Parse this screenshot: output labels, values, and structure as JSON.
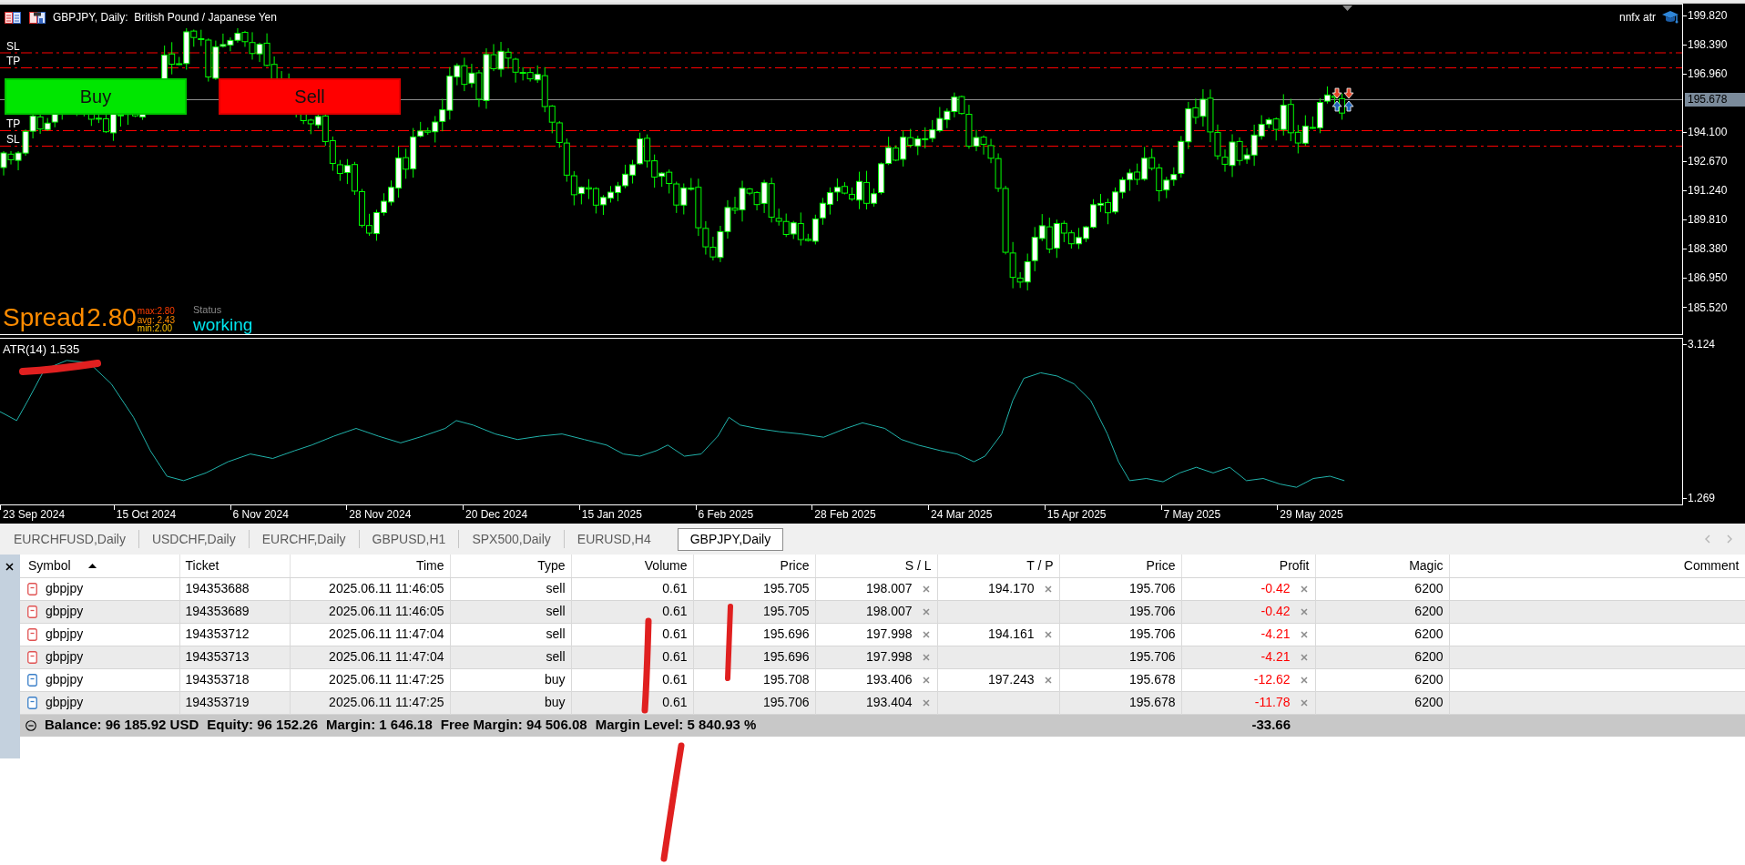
{
  "chart_window": {
    "title": "GBPJPY, Daily:  British Pound / Japanese Yen",
    "expert_name": "nnfx atr",
    "levels": [
      {
        "label": "SL"
      },
      {
        "label": "TP"
      },
      {
        "label": "TP"
      },
      {
        "label": "SL"
      }
    ],
    "trade_buttons": [
      {
        "kind": "buy",
        "label": "Buy"
      },
      {
        "kind": "sell",
        "label": "Sell"
      }
    ],
    "spread": {
      "label": "Spread",
      "value": "2.80",
      "stats": [
        {
          "kind": "max",
          "text": "max:2.80"
        },
        {
          "kind": "avg",
          "text": "avg: 2.43"
        },
        {
          "kind": "min",
          "text": "min:2.00"
        }
      ]
    },
    "status": {
      "label": "Status",
      "value": "working"
    },
    "price_axis": [
      "199.820",
      "198.390",
      "196.960",
      "194.100",
      "192.670",
      "191.240",
      "189.810",
      "188.380",
      "186.950",
      "185.520"
    ],
    "current_price": "195.678",
    "indicator": {
      "label": "ATR(14) 1.535",
      "axis": [
        "3.124",
        "1.269"
      ]
    },
    "date_axis": [
      "23 Sep 2024",
      "15 Oct 2024",
      "6 Nov 2024",
      "28 Nov 2024",
      "20 Dec 2024",
      "15 Jan 2025",
      "6 Feb 2025",
      "28 Feb 2025",
      "24 Mar 2025",
      "15 Apr 2025",
      "7 May 2025",
      "29 May 2025"
    ]
  },
  "chart_tabs": [
    {
      "label": "EURCHFUSD,Daily",
      "selected": false
    },
    {
      "label": "USDCHF,Daily",
      "selected": false
    },
    {
      "label": "EURCHF,Daily",
      "selected": false
    },
    {
      "label": "GBPUSD,H1",
      "selected": false
    },
    {
      "label": "SPX500,Daily",
      "selected": false
    },
    {
      "label": "EURUSD,H4",
      "selected": false
    },
    {
      "label": "GBPJPY,Daily",
      "selected": true
    }
  ],
  "trade_table": {
    "columns": [
      {
        "label": "Symbol",
        "sort_ascending": true
      },
      {
        "label": "Ticket"
      },
      {
        "label": "Time"
      },
      {
        "label": "Type"
      },
      {
        "label": "Volume"
      },
      {
        "label": "Price"
      },
      {
        "label": "S / L"
      },
      {
        "label": "T / P"
      },
      {
        "label": "Price"
      },
      {
        "label": "Profit"
      },
      {
        "label": "Magic"
      },
      {
        "label": "Comment"
      }
    ],
    "rows": [
      {
        "kind": "sell",
        "symbol": "gbpjpy",
        "ticket": "194353688",
        "time": "2025.06.11 11:46:05",
        "type": "sell",
        "volume": "0.61",
        "price": "195.705",
        "sl": "198.007",
        "tp": "194.170",
        "current_price": "195.706",
        "profit": "-0.42",
        "loss": true,
        "magic": "6200"
      },
      {
        "kind": "sell",
        "symbol": "gbpjpy",
        "ticket": "194353689",
        "time": "2025.06.11 11:46:05",
        "type": "sell",
        "volume": "0.61",
        "price": "195.705",
        "sl": "198.007",
        "current_price": "195.706",
        "profit": "-0.42",
        "loss": true,
        "magic": "6200"
      },
      {
        "kind": "sell",
        "symbol": "gbpjpy",
        "ticket": "194353712",
        "time": "2025.06.11 11:47:04",
        "type": "sell",
        "volume": "0.61",
        "price": "195.696",
        "sl": "197.998",
        "tp": "194.161",
        "current_price": "195.706",
        "profit": "-4.21",
        "loss": true,
        "magic": "6200"
      },
      {
        "kind": "sell",
        "symbol": "gbpjpy",
        "ticket": "194353713",
        "time": "2025.06.11 11:47:04",
        "type": "sell",
        "volume": "0.61",
        "price": "195.696",
        "sl": "197.998",
        "current_price": "195.706",
        "profit": "-4.21",
        "loss": true,
        "magic": "6200"
      },
      {
        "kind": "buy",
        "symbol": "gbpjpy",
        "ticket": "194353718",
        "time": "2025.06.11 11:47:25",
        "type": "buy",
        "volume": "0.61",
        "price": "195.708",
        "sl": "193.406",
        "tp": "197.243",
        "current_price": "195.678",
        "profit": "-12.62",
        "loss": true,
        "magic": "6200"
      },
      {
        "kind": "buy",
        "symbol": "gbpjpy",
        "ticket": "194353719",
        "time": "2025.06.11 11:47:25",
        "type": "buy",
        "volume": "0.61",
        "price": "195.706",
        "sl": "193.404",
        "current_price": "195.678",
        "profit": "-11.78",
        "loss": true,
        "magic": "6200"
      }
    ],
    "summary": {
      "items": [
        "Balance: 96 185.92 USD",
        "Equity: 96 152.26",
        "Margin: 1 646.18",
        "Free Margin: 94 506.08",
        "Margin Level: 5 840.93 %"
      ],
      "total_profit": "-33.66"
    }
  }
}
